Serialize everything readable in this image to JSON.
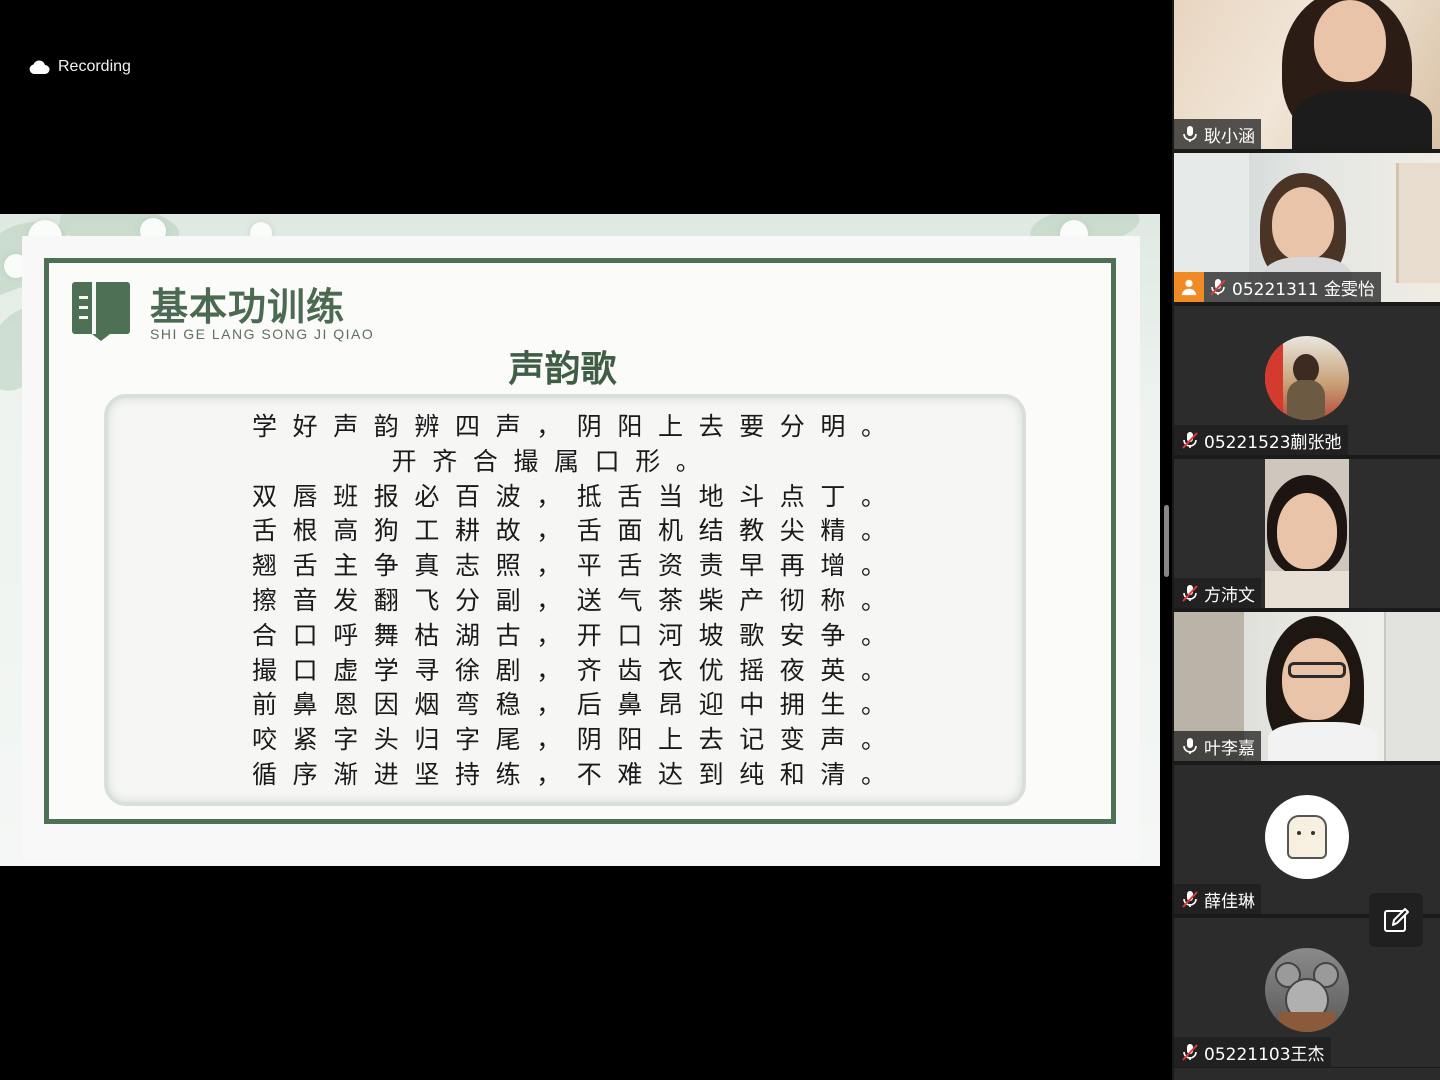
{
  "recording": {
    "label": "Recording",
    "icon": "cloud-icon"
  },
  "slide": {
    "title": "基本功训练",
    "subtitle": "SHI GE LANG SONG JI QIAO",
    "poem_title": "声韵歌",
    "poem_lines": [
      "学好声韵辨四声，阴阳上去要分明。",
      "开齐合撮属口形。",
      "双唇班报必百波，抵舌当地斗点丁。",
      "舌根高狗工耕故，舌面机结教尖精。",
      "翘舌主争真志照，平舌资责早再增。",
      "擦音发翻飞分副，送气茶柴产彻称。",
      "合口呼舞枯湖古，开口河坡歌安争。",
      "撮口虚学寻徐剧，齐齿衣优摇夜英。",
      "前鼻恩因烟弯稳，后鼻昂迎中拥生。",
      "咬紧字头归字尾，阴阳上去记变声。",
      "循序渐进坚持练，不难达到纯和清。"
    ],
    "accent_color": "#4e7055"
  },
  "participants": [
    {
      "name": "耿小涵",
      "mic": "unmuted"
    },
    {
      "name": "05221311 金雯怡",
      "mic": "muted",
      "host": true
    },
    {
      "name": "05221523蒯张弛",
      "mic": "muted"
    },
    {
      "name": "方沛文",
      "mic": "muted"
    },
    {
      "name": "叶李嘉",
      "mic": "unmuted"
    },
    {
      "name": "薛佳琳",
      "mic": "muted"
    },
    {
      "name": "05221103王杰",
      "mic": "muted"
    }
  ]
}
